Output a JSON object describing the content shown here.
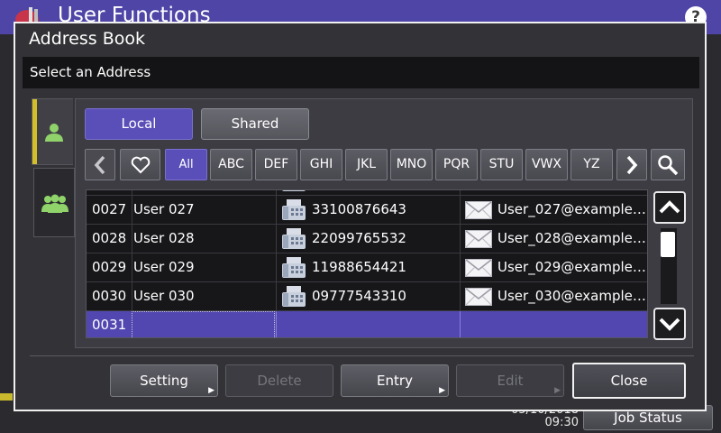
{
  "background": {
    "title": "User Functions",
    "help_icon": "?",
    "date": "05/10/2018",
    "time": "09:30",
    "job_status_label": "Job Status"
  },
  "dialog": {
    "title": "Address Book",
    "subtitle": "Select an Address"
  },
  "toggle": {
    "local_label": "Local",
    "shared_label": "Shared",
    "selected": "Local"
  },
  "index_tabs": [
    "All",
    "ABC",
    "DEF",
    "GHI",
    "JKL",
    "MNO",
    "PQR",
    "STU",
    "VWX",
    "YZ"
  ],
  "active_index": "All",
  "icons": {
    "prev": "chevron-left-icon",
    "favorite": "heart-icon",
    "next": "chevron-right-icon",
    "search": "search-icon",
    "individual_tab": "person-icon",
    "group_tab": "group-icon",
    "fax": "fax-icon",
    "mail": "envelope-icon"
  },
  "rows": [
    {
      "num": "0027",
      "name": "User 027",
      "fax": "33100876643",
      "email": "User_027@example.c···"
    },
    {
      "num": "0028",
      "name": "User 028",
      "fax": "22099765532",
      "email": "User_028@example.c···"
    },
    {
      "num": "0029",
      "name": "User 029",
      "fax": "11988654421",
      "email": "User_029@example.c···"
    },
    {
      "num": "0030",
      "name": "User 030",
      "fax": "09777543310",
      "email": "User_030@example.c···"
    },
    {
      "num": "0031",
      "name": "",
      "fax": "",
      "email": ""
    }
  ],
  "buttons": {
    "setting": "Setting",
    "delete": "Delete",
    "entry": "Entry",
    "edit": "Edit",
    "close": "Close"
  },
  "colors": {
    "accent": "#5a4fb8",
    "selected_row": "#5247b0",
    "tab_indicator": "#d4bf2b",
    "header": "#4e45a6",
    "icon_green": "#8fd36a"
  }
}
